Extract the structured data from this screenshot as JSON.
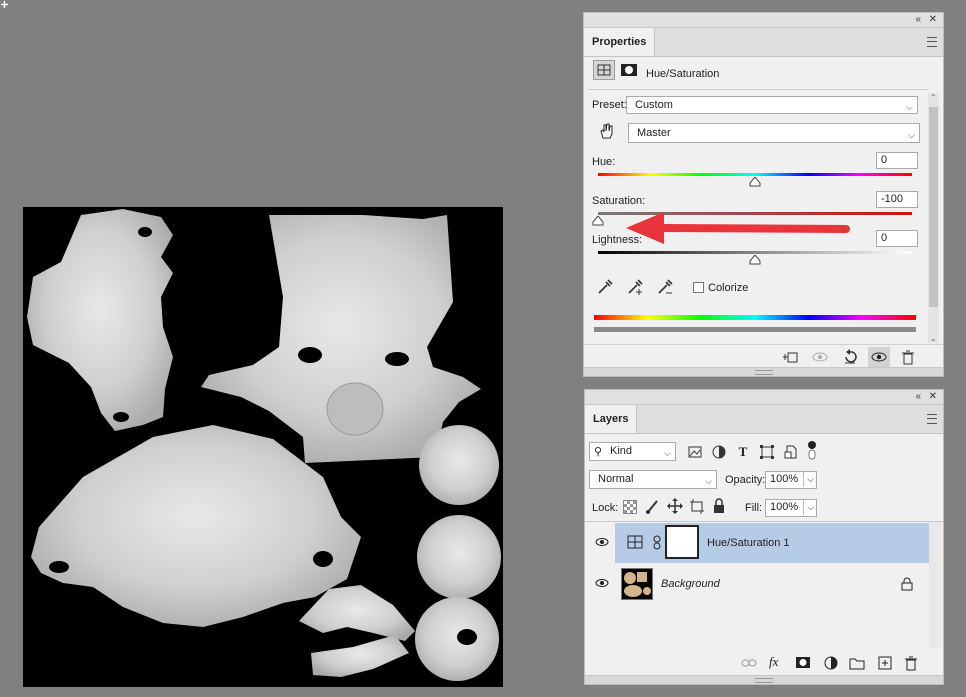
{
  "canvas": {
    "background": "#000000"
  },
  "properties_panel": {
    "tab": "Properties",
    "adjustment_name": "Hue/Saturation",
    "preset_label": "Preset:",
    "preset_value": "Custom",
    "channel_value": "Master",
    "hue": {
      "label": "Hue:",
      "value": "0",
      "level_percent": 50
    },
    "saturation": {
      "label": "Saturation:",
      "value": "-100",
      "level_percent": 0
    },
    "lightness": {
      "label": "Lightness:",
      "value": "0",
      "level_percent": 50
    },
    "colorize_label": "Colorize",
    "colorize_checked": false,
    "footer_icons": [
      "clip-to-layer-icon",
      "view-previous-icon",
      "reset-icon",
      "visibility-icon",
      "trash-icon"
    ]
  },
  "annotation": {
    "arrow_color": "#e8353c"
  },
  "layers_panel": {
    "tab": "Layers",
    "filter_value": "Kind",
    "blend_mode": "Normal",
    "opacity_label": "Opacity:",
    "opacity_value": "100%",
    "lock_label": "Lock:",
    "fill_label": "Fill:",
    "fill_value": "100%",
    "layers": [
      {
        "name": "Hue/Saturation 1",
        "selected": true,
        "visible": true
      },
      {
        "name": "Background",
        "selected": false,
        "visible": true,
        "locked": true
      }
    ],
    "selected_color": "#b6cbe6",
    "footer_icons": [
      "link-icon",
      "fx-icon",
      "mask-icon",
      "adjustment-icon",
      "folder-icon",
      "new-layer-icon",
      "trash-icon"
    ]
  }
}
